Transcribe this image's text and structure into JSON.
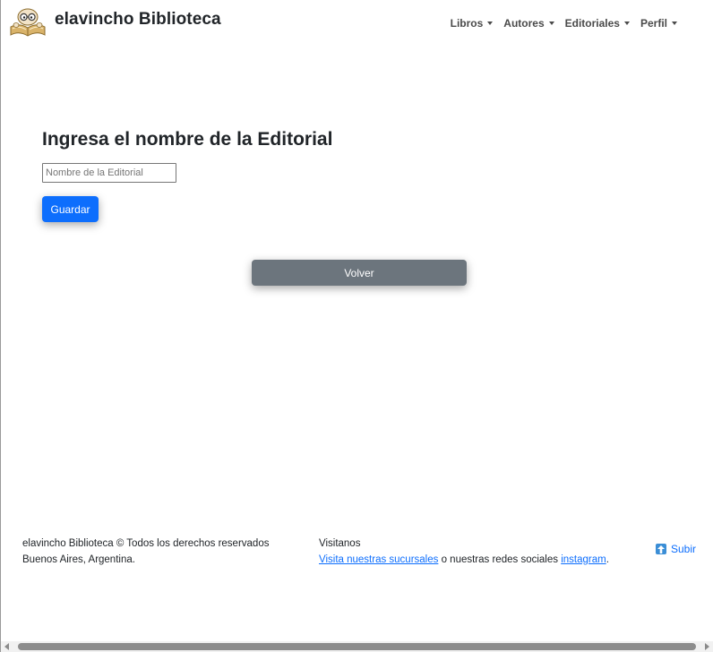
{
  "navbar": {
    "brand_name": "elavincho Biblioteca",
    "logo_icon": "book-reading-logo",
    "menu": [
      {
        "label": "Libros"
      },
      {
        "label": "Autores"
      },
      {
        "label": "Editoriales"
      },
      {
        "label": "Perfil"
      }
    ]
  },
  "form": {
    "title": "Ingresa el nombre de la Editorial",
    "name_placeholder": "Nombre de la Editorial",
    "name_value": "",
    "save_label": "Guardar",
    "back_label": "Volver"
  },
  "footer": {
    "copyright": "elavincho Biblioteca © Todos los derechos reservados",
    "location": "Buenos Aires, Argentina.",
    "visit_heading": "Visitanos",
    "branches_link": "Visita nuestras sucursales",
    "social_text": " o nuestras redes sociales ",
    "instagram_link": "instagram",
    "period": ".",
    "up_label": "Subir",
    "up_icon": "arrow-up-icon"
  },
  "colors": {
    "primary": "#0d6efd",
    "secondary": "#6c757d",
    "text": "#212529"
  }
}
